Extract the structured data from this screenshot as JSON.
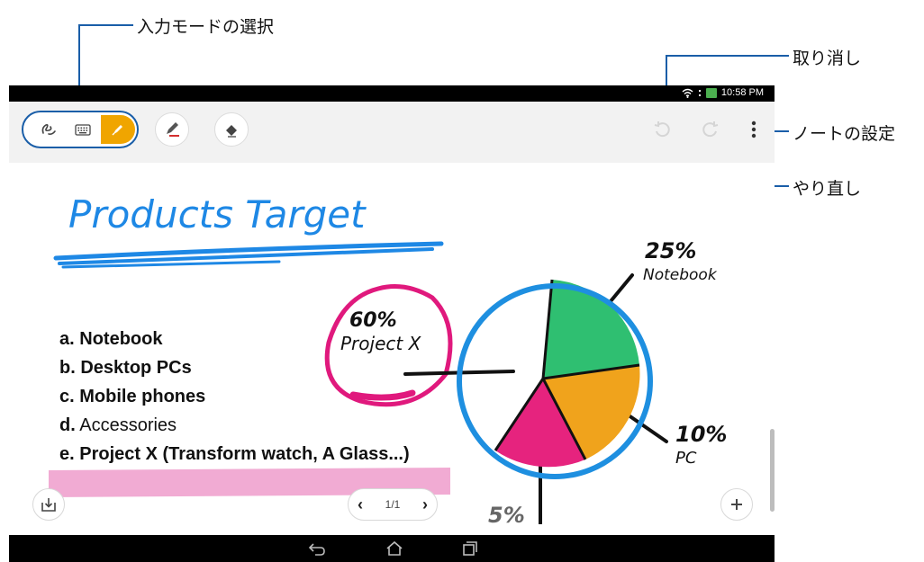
{
  "callouts": {
    "input_mode": "入力モードの選択",
    "undo": "取り消し",
    "note_settings": "ノートの設定",
    "redo": "やり直し"
  },
  "status_bar": {
    "time": "10:58 PM",
    "icons": [
      "wifi-icon",
      "signal-icon",
      "battery-charging-icon"
    ]
  },
  "toolbar": {
    "mode_icons": [
      "handwriting-icon",
      "keyboard-icon",
      "pen-icon"
    ],
    "active_mode": "pen",
    "pen_tool_icon": "pen-color-icon",
    "eraser_icon": "eraser-icon",
    "undo_icon": "undo-icon",
    "redo_icon": "redo-icon",
    "menu_icon": "more-vert-icon",
    "accent_color": "#f0a500",
    "highlight_color": "#1a5ea8"
  },
  "note": {
    "handwritten_title": "Products Target",
    "list": [
      {
        "prefix": "a.",
        "text": "Notebook",
        "bold": true
      },
      {
        "prefix": "b.",
        "text": "Desktop PCs",
        "bold": true
      },
      {
        "prefix": "c.",
        "text": "Mobile phones",
        "bold": true
      },
      {
        "prefix": "d.",
        "text": "Accessories",
        "bold": false
      },
      {
        "prefix": "e.",
        "text": "Project X (Transform watch, A Glass...)",
        "bold": true
      }
    ],
    "chart_labels": {
      "notebook_pct": "25%",
      "notebook_name": "Notebook",
      "projectx_pct": "60%",
      "projectx_name": "Project X",
      "pc_pct": "10%",
      "pc_name": "PC",
      "other_pct": "5%"
    }
  },
  "bottom_controls": {
    "import_icon": "import-icon",
    "page_indicator": "1/1",
    "prev_icon": "chevron-left-icon",
    "next_icon": "chevron-right-icon",
    "add_icon": "plus-icon"
  },
  "nav_bar": {
    "icons": [
      "back-icon",
      "home-icon",
      "recent-apps-icon"
    ]
  }
}
